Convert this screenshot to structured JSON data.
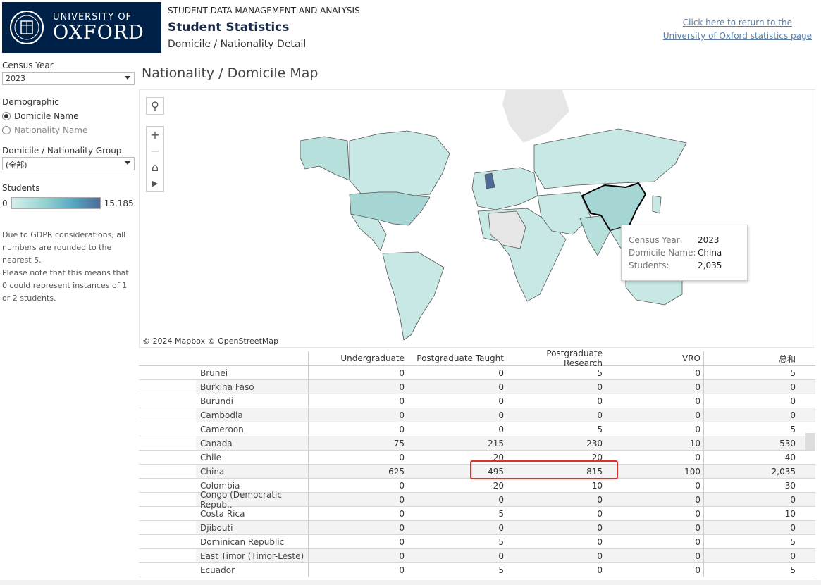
{
  "header": {
    "logo_line1": "UNIVERSITY OF",
    "logo_line2": "OXFORD",
    "subtitle": "STUDENT DATA MANAGEMENT AND ANALYSIS",
    "title": "Student Statistics",
    "detail": "Domicile / Nationality Detail",
    "link_line1": "Click here to return to the",
    "link_line2": "University of Oxford statistics page"
  },
  "sidebar": {
    "census_label": "Census Year",
    "census_value": "2023",
    "demographic_label": "Demographic",
    "radio_domicile": "Domicile Name",
    "radio_nationality": "Nationality Name",
    "group_label": "Domicile / Nationality Group",
    "group_value": "(全部)",
    "students_label": "Students",
    "legend_min": "0",
    "legend_max": "15,185",
    "note1": "Due to GDPR considerations, all numbers are rounded to the nearest 5.",
    "note2": "Please note that this means that 0 could represent instances of 1 or 2 students."
  },
  "map": {
    "title": "Nationality / Domicile Map",
    "attribution": "© 2024 Mapbox  © OpenStreetMap",
    "tooltip": {
      "k1": "Census Year:",
      "v1": "2023",
      "k2": "Domicile Name:",
      "v2": "China",
      "k3": "Students:",
      "v3": "2,035"
    },
    "colors": {
      "low": "#d6efec",
      "mid": "#8fd0cf",
      "high": "#4e6a97",
      "none": "#e6e6e6"
    }
  },
  "table": {
    "headers": [
      "Undergraduate",
      "Postgraduate Taught",
      "Postgraduate Research",
      "VRO",
      "总和"
    ],
    "rows": [
      {
        "name": "Brunei",
        "v": [
          "0",
          "0",
          "5",
          "0",
          "5"
        ]
      },
      {
        "name": "Burkina Faso",
        "v": [
          "0",
          "0",
          "0",
          "0",
          "0"
        ]
      },
      {
        "name": "Burundi",
        "v": [
          "0",
          "0",
          "0",
          "0",
          "0"
        ]
      },
      {
        "name": "Cambodia",
        "v": [
          "0",
          "0",
          "0",
          "0",
          "0"
        ]
      },
      {
        "name": "Cameroon",
        "v": [
          "0",
          "0",
          "5",
          "0",
          "5"
        ]
      },
      {
        "name": "Canada",
        "v": [
          "75",
          "215",
          "230",
          "10",
          "530"
        ]
      },
      {
        "name": "Chile",
        "v": [
          "0",
          "20",
          "20",
          "0",
          "40"
        ]
      },
      {
        "name": "China",
        "v": [
          "625",
          "495",
          "815",
          "100",
          "2,035"
        ]
      },
      {
        "name": "Colombia",
        "v": [
          "0",
          "20",
          "10",
          "0",
          "30"
        ]
      },
      {
        "name": "Congo (Democratic Repub..",
        "v": [
          "0",
          "0",
          "0",
          "0",
          "0"
        ]
      },
      {
        "name": "Costa Rica",
        "v": [
          "0",
          "5",
          "0",
          "0",
          "10"
        ]
      },
      {
        "name": "Djibouti",
        "v": [
          "0",
          "0",
          "0",
          "0",
          "0"
        ]
      },
      {
        "name": "Dominican Republic",
        "v": [
          "0",
          "5",
          "0",
          "0",
          "5"
        ]
      },
      {
        "name": "East Timor (Timor-Leste)",
        "v": [
          "0",
          "0",
          "0",
          "0",
          "0"
        ]
      },
      {
        "name": "Ecuador",
        "v": [
          "0",
          "5",
          "0",
          "0",
          "5"
        ]
      }
    ]
  }
}
